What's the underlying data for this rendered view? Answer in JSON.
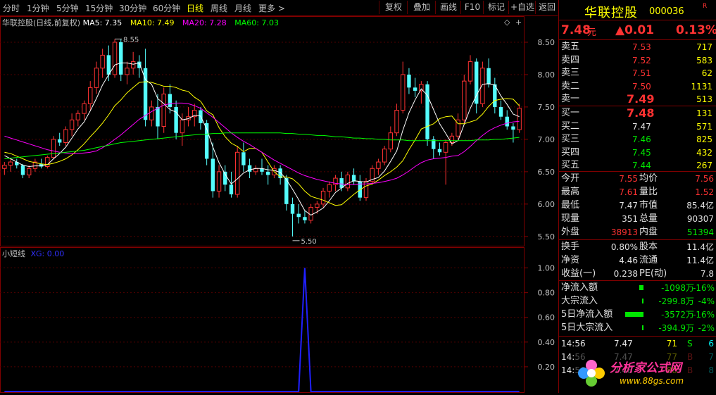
{
  "toolbar": {
    "periods": [
      "分时",
      "1分钟",
      "5分钟",
      "15分钟",
      "30分钟",
      "60分钟",
      "日线",
      "周线",
      "月线",
      "更多 >"
    ],
    "active_period": "日线",
    "buttons": [
      "复权",
      "叠加",
      "画线",
      "F10",
      "标记",
      "+自选",
      "返回"
    ]
  },
  "main_chart": {
    "title": "华联控股(日线,前复权)",
    "ma_legend": [
      {
        "label": "MA5: 7.35",
        "color": "#ffffff"
      },
      {
        "label": "MA10: 7.49",
        "color": "#ffff00"
      },
      {
        "label": "MA20: 7.28",
        "color": "#ff00ff"
      },
      {
        "label": "MA60: 7.03",
        "color": "#00ff00"
      }
    ],
    "high_label": "8.55",
    "low_label": "5.50",
    "y_ticks": [
      "8.50",
      "8.00",
      "7.50",
      "7.00",
      "6.50",
      "6.00",
      "5.50"
    ]
  },
  "sub_chart": {
    "title": "小短线",
    "legend": "XG: 0.00",
    "y_ticks": [
      "1.00",
      "0.80",
      "0.60",
      "0.40",
      "0.20"
    ]
  },
  "chart_data": {
    "type": "line",
    "title": "华联控股(日线,前复权)",
    "ylim": [
      5.4,
      8.75
    ],
    "candles": [
      [
        6.55,
        6.65,
        6.45,
        6.6
      ],
      [
        6.6,
        6.7,
        6.5,
        6.65
      ],
      [
        6.65,
        6.7,
        6.55,
        6.6
      ],
      [
        6.6,
        6.62,
        6.4,
        6.45
      ],
      [
        6.45,
        6.6,
        6.4,
        6.55
      ],
      [
        6.55,
        6.7,
        6.5,
        6.65
      ],
      [
        6.62,
        6.7,
        6.55,
        6.58
      ],
      [
        6.58,
        6.75,
        6.55,
        6.72
      ],
      [
        6.72,
        7.05,
        6.7,
        7.0
      ],
      [
        7.0,
        7.1,
        6.9,
        6.95
      ],
      [
        6.95,
        7.2,
        6.9,
        7.15
      ],
      [
        7.15,
        7.4,
        7.05,
        7.3
      ],
      [
        7.3,
        7.45,
        7.2,
        7.4
      ],
      [
        7.4,
        7.6,
        7.3,
        7.55
      ],
      [
        7.55,
        7.9,
        7.45,
        7.8
      ],
      [
        7.8,
        8.2,
        7.7,
        8.1
      ],
      [
        8.1,
        8.4,
        7.95,
        8.3
      ],
      [
        8.3,
        8.45,
        7.9,
        8.0
      ],
      [
        8.0,
        8.55,
        7.95,
        8.5
      ],
      [
        8.5,
        8.55,
        7.9,
        8.0
      ],
      [
        8.0,
        8.2,
        7.85,
        8.1
      ],
      [
        8.1,
        8.35,
        8.0,
        8.2
      ],
      [
        8.2,
        8.3,
        7.95,
        8.1
      ],
      [
        8.1,
        8.4,
        7.2,
        7.3
      ],
      [
        7.3,
        7.6,
        7.2,
        7.5
      ],
      [
        7.5,
        7.7,
        7.0,
        7.2
      ],
      [
        7.2,
        7.8,
        7.1,
        7.7
      ],
      [
        7.7,
        7.85,
        7.4,
        7.5
      ],
      [
        7.5,
        7.6,
        7.0,
        7.1
      ],
      [
        7.1,
        7.4,
        6.9,
        7.3
      ],
      [
        7.3,
        7.5,
        7.2,
        7.35
      ],
      [
        7.35,
        7.55,
        7.2,
        7.45
      ],
      [
        7.45,
        7.5,
        7.15,
        7.25
      ],
      [
        7.25,
        7.3,
        6.6,
        6.7
      ],
      [
        6.7,
        6.95,
        6.1,
        6.2
      ],
      [
        6.2,
        6.6,
        6.1,
        6.5
      ],
      [
        6.5,
        6.6,
        6.2,
        6.3
      ],
      [
        6.3,
        6.5,
        6.1,
        6.15
      ],
      [
        6.15,
        6.9,
        6.1,
        6.8
      ],
      [
        6.8,
        6.95,
        6.5,
        6.6
      ],
      [
        6.6,
        6.7,
        6.4,
        6.5
      ],
      [
        6.5,
        6.6,
        6.45,
        6.55
      ],
      [
        6.55,
        6.7,
        6.45,
        6.5
      ],
      [
        6.5,
        6.6,
        6.3,
        6.45
      ],
      [
        6.45,
        6.6,
        6.4,
        6.55
      ],
      [
        6.55,
        6.6,
        6.3,
        6.4
      ],
      [
        6.4,
        6.45,
        5.9,
        6.0
      ],
      [
        6.0,
        6.1,
        5.5,
        5.85
      ],
      [
        5.85,
        6.0,
        5.7,
        5.8
      ],
      [
        5.8,
        5.9,
        5.7,
        5.75
      ],
      [
        5.75,
        6.0,
        5.7,
        5.95
      ],
      [
        5.95,
        6.05,
        5.85,
        6.0
      ],
      [
        6.0,
        6.25,
        5.95,
        6.2
      ],
      [
        6.2,
        6.35,
        6.1,
        6.3
      ],
      [
        6.3,
        6.45,
        6.2,
        6.4
      ],
      [
        6.4,
        6.5,
        6.2,
        6.25
      ],
      [
        6.25,
        6.5,
        6.2,
        6.45
      ],
      [
        6.45,
        6.55,
        6.3,
        6.35
      ],
      [
        6.35,
        6.45,
        6.05,
        6.1
      ],
      [
        6.1,
        6.4,
        6.05,
        6.35
      ],
      [
        6.35,
        6.6,
        6.3,
        6.55
      ],
      [
        6.55,
        6.7,
        6.45,
        6.65
      ],
      [
        6.65,
        6.9,
        6.6,
        6.85
      ],
      [
        6.85,
        7.2,
        6.8,
        7.1
      ],
      [
        7.1,
        7.55,
        7.05,
        7.45
      ],
      [
        7.45,
        8.2,
        7.4,
        8.0
      ],
      [
        8.0,
        8.1,
        7.7,
        7.8
      ],
      [
        7.8,
        7.95,
        7.65,
        7.75
      ],
      [
        7.75,
        7.9,
        7.55,
        7.85
      ],
      [
        7.85,
        7.9,
        6.9,
        7.0
      ],
      [
        7.0,
        7.05,
        6.7,
        6.85
      ],
      [
        6.85,
        6.95,
        6.75,
        6.8
      ],
      [
        6.8,
        7.0,
        6.3,
        6.95
      ],
      [
        6.95,
        7.1,
        6.9,
        7.05
      ],
      [
        7.05,
        7.4,
        7.0,
        7.3
      ],
      [
        7.3,
        8.0,
        7.25,
        7.9
      ],
      [
        7.9,
        8.3,
        7.85,
        8.2
      ],
      [
        8.2,
        8.25,
        7.4,
        7.55
      ],
      [
        7.55,
        8.2,
        7.5,
        8.1
      ],
      [
        8.1,
        8.25,
        7.8,
        7.85
      ],
      [
        7.85,
        7.95,
        7.4,
        7.5
      ],
      [
        7.5,
        7.6,
        7.3,
        7.35
      ],
      [
        7.35,
        7.45,
        7.15,
        7.2
      ],
      [
        7.2,
        7.25,
        6.95,
        7.15
      ],
      [
        7.15,
        7.55,
        7.1,
        7.48
      ]
    ],
    "series": [
      {
        "name": "MA5",
        "color": "#ffffff",
        "values": [
          6.75,
          6.7,
          6.65,
          6.6,
          6.58,
          6.59,
          6.59,
          6.61,
          6.7,
          6.78,
          6.88,
          7.02,
          7.16,
          7.27,
          7.44,
          7.63,
          7.84,
          8.0,
          8.15,
          8.18,
          8.18,
          8.16,
          8.18,
          7.92,
          7.85,
          7.63,
          7.55,
          7.46,
          7.42,
          7.3,
          7.32,
          7.37,
          7.36,
          7.16,
          6.88,
          6.64,
          6.46,
          6.31,
          6.39,
          6.48,
          6.53,
          6.55,
          6.55,
          6.53,
          6.52,
          6.49,
          6.38,
          6.23,
          6.07,
          5.9,
          5.83,
          5.88,
          5.94,
          6.05,
          6.18,
          6.25,
          6.32,
          6.36,
          6.35,
          6.34,
          6.38,
          6.41,
          6.51,
          6.66,
          6.82,
          7.14,
          7.41,
          7.61,
          7.78,
          7.68,
          7.46,
          7.24,
          7.09,
          6.93,
          6.98,
          7.23,
          7.48,
          7.68,
          7.85,
          7.86,
          7.84,
          7.67,
          7.54,
          7.39,
          7.35
        ]
      },
      {
        "name": "MA10",
        "color": "#ffff00",
        "values": [
          6.8,
          6.78,
          6.74,
          6.7,
          6.66,
          6.64,
          6.62,
          6.61,
          6.63,
          6.66,
          6.7,
          6.76,
          6.84,
          6.93,
          7.04,
          7.14,
          7.25,
          7.38,
          7.52,
          7.61,
          7.72,
          7.8,
          7.88,
          7.89,
          7.88,
          7.85,
          7.82,
          7.82,
          7.8,
          7.76,
          7.74,
          7.65,
          7.59,
          7.44,
          7.38,
          7.18,
          7.04,
          6.94,
          6.89,
          6.81,
          6.86,
          6.86,
          6.8,
          6.65,
          6.5,
          6.42,
          6.42,
          6.39,
          6.31,
          6.2,
          6.12,
          6.09,
          6.06,
          6.02,
          5.98,
          5.99,
          6.07,
          6.15,
          6.22,
          6.28,
          6.31,
          6.37,
          6.44,
          6.5,
          6.57,
          6.67,
          6.84,
          6.99,
          7.16,
          7.2,
          7.24,
          7.32,
          7.35,
          7.36,
          7.24,
          7.24,
          7.27,
          7.3,
          7.39,
          7.51,
          7.6,
          7.62,
          7.63,
          7.62,
          7.52
        ]
      },
      {
        "name": "MA20",
        "color": "#ff00ff",
        "values": [
          7.05,
          7.02,
          6.99,
          6.96,
          6.93,
          6.9,
          6.87,
          6.84,
          6.82,
          6.8,
          6.79,
          6.78,
          6.78,
          6.79,
          6.8,
          6.82,
          6.87,
          6.93,
          7.0,
          7.07,
          7.15,
          7.23,
          7.31,
          7.37,
          7.43,
          7.48,
          7.53,
          7.55,
          7.56,
          7.56,
          7.55,
          7.52,
          7.48,
          7.41,
          7.34,
          7.26,
          7.18,
          7.1,
          7.03,
          6.97,
          6.92,
          6.86,
          6.8,
          6.74,
          6.68,
          6.63,
          6.58,
          6.53,
          6.48,
          6.44,
          6.41,
          6.38,
          6.36,
          6.34,
          6.32,
          6.31,
          6.3,
          6.3,
          6.31,
          6.31,
          6.32,
          6.33,
          6.35,
          6.37,
          6.4,
          6.45,
          6.51,
          6.58,
          6.64,
          6.68,
          6.7,
          6.71,
          6.72,
          6.74,
          6.75,
          6.81,
          6.89,
          6.98,
          7.06,
          7.13,
          7.18,
          7.22,
          7.25,
          7.27,
          7.28
        ]
      },
      {
        "name": "MA60",
        "color": "#00ff00",
        "values": [
          6.7,
          6.71,
          6.72,
          6.73,
          6.74,
          6.75,
          6.76,
          6.77,
          6.78,
          6.79,
          6.8,
          6.81,
          6.82,
          6.83,
          6.85,
          6.87,
          6.89,
          6.91,
          6.93,
          6.95,
          6.96,
          6.97,
          6.98,
          6.99,
          7.0,
          7.01,
          7.02,
          7.03,
          7.04,
          7.05,
          7.06,
          7.07,
          7.08,
          7.08,
          7.09,
          7.09,
          7.1,
          7.1,
          7.1,
          7.1,
          7.1,
          7.1,
          7.1,
          7.1,
          7.1,
          7.1,
          7.09,
          7.09,
          7.08,
          7.08,
          7.07,
          7.06,
          7.06,
          7.05,
          7.04,
          7.04,
          7.03,
          7.02,
          7.02,
          7.01,
          7.01,
          7.0,
          7.0,
          6.99,
          6.99,
          6.99,
          6.98,
          6.98,
          6.98,
          6.98,
          6.98,
          6.98,
          6.98,
          6.98,
          6.98,
          6.98,
          6.98,
          6.99,
          6.99,
          6.99,
          7.0,
          7.0,
          7.01,
          7.02,
          7.03
        ]
      }
    ],
    "xg_values": [
      0,
      0,
      0,
      0,
      0,
      0,
      0,
      0,
      0,
      0,
      0,
      0,
      0,
      0,
      0,
      0,
      0,
      0,
      0,
      0,
      0,
      0,
      0,
      0,
      0,
      0,
      0,
      0,
      0,
      0,
      0,
      0,
      0,
      0,
      0,
      0,
      0,
      0,
      0,
      0,
      0,
      0,
      0,
      0,
      0,
      0,
      0,
      0,
      0,
      0,
      0,
      0,
      0,
      0,
      0,
      0,
      0,
      0,
      0,
      0,
      0,
      0,
      0,
      0,
      0,
      0,
      0,
      0,
      0,
      0,
      0,
      0,
      0,
      0,
      0,
      0,
      0,
      0,
      0,
      0,
      0,
      0,
      0,
      0,
      0
    ],
    "xg_spike_index": 49,
    "xg_ylim": [
      0,
      1.1
    ]
  },
  "quote": {
    "name": "华联控股",
    "code": "000036",
    "flag": "R",
    "price": "7.48",
    "price_unit": "元",
    "change": "▲0.01",
    "change_pct": "0.13%",
    "asks": [
      {
        "label": "卖五",
        "price": "7.53",
        "vol": "717"
      },
      {
        "label": "卖四",
        "price": "7.52",
        "vol": "583"
      },
      {
        "label": "卖三",
        "price": "7.51",
        "vol": "62"
      },
      {
        "label": "卖二",
        "price": "7.50",
        "vol": "1131"
      },
      {
        "label": "卖一",
        "price": "7.49",
        "vol": "513"
      }
    ],
    "bids": [
      {
        "label": "买一",
        "price": "7.48",
        "vol": "131"
      },
      {
        "label": "买二",
        "price": "7.47",
        "vol": "571"
      },
      {
        "label": "买三",
        "price": "7.46",
        "vol": "825"
      },
      {
        "label": "买四",
        "price": "7.45",
        "vol": "432"
      },
      {
        "label": "买五",
        "price": "7.44",
        "vol": "267"
      }
    ],
    "stats": [
      {
        "l1": "今开",
        "v1": "7.55",
        "c1": "red",
        "l2": "均价",
        "v2": "7.56",
        "c2": "red"
      },
      {
        "l1": "最高",
        "v1": "7.61",
        "c1": "red",
        "l2": "量比",
        "v2": "1.52",
        "c2": "red"
      },
      {
        "l1": "最低",
        "v1": "7.47",
        "c1": "white",
        "l2": "市值",
        "v2": "85.4亿",
        "c2": "white"
      },
      {
        "l1": "现量",
        "v1": "351",
        "c1": "white",
        "l2": "总量",
        "v2": "90307",
        "c2": "white"
      },
      {
        "l1": "外盘",
        "v1": "38913",
        "c1": "red",
        "l2": "内盘",
        "v2": "51394",
        "c2": "green"
      }
    ],
    "stats2": [
      {
        "l1": "换手",
        "v1": "0.80%",
        "l2": "股本",
        "v2": "11.4亿"
      },
      {
        "l1": "净资",
        "v1": "4.46",
        "l2": "流通",
        "v2": "11.4亿"
      },
      {
        "l1": "收益(一)",
        "v1": "0.238",
        "l2": "PE(动)",
        "v2": "7.8"
      }
    ],
    "flows": [
      {
        "label": "净流入额",
        "value": "-1098万",
        "pct": "-16%",
        "bar": 6
      },
      {
        "label": "大宗流入",
        "value": "-299.8万",
        "pct": "-4%",
        "bar": 2
      },
      {
        "label": "5日净流入额",
        "value": "-3572万",
        "pct": "-16%",
        "bar": 26
      },
      {
        "label": "5日大宗流入",
        "value": "-394.9万",
        "pct": "-2%",
        "bar": 2
      }
    ],
    "ticks": [
      {
        "time": "14:56",
        "price": "7.47",
        "vol": "71",
        "side": "S",
        "n": "6"
      },
      {
        "time": "14:56",
        "price": "7.47",
        "vol": "77",
        "side": "B",
        "n": "7"
      },
      {
        "time": "14:56",
        "price": "7.48",
        "vol": "88",
        "side": "B",
        "n": "8"
      }
    ]
  },
  "watermark": {
    "text": "分析家公式网",
    "url": "www.88gs.com"
  }
}
